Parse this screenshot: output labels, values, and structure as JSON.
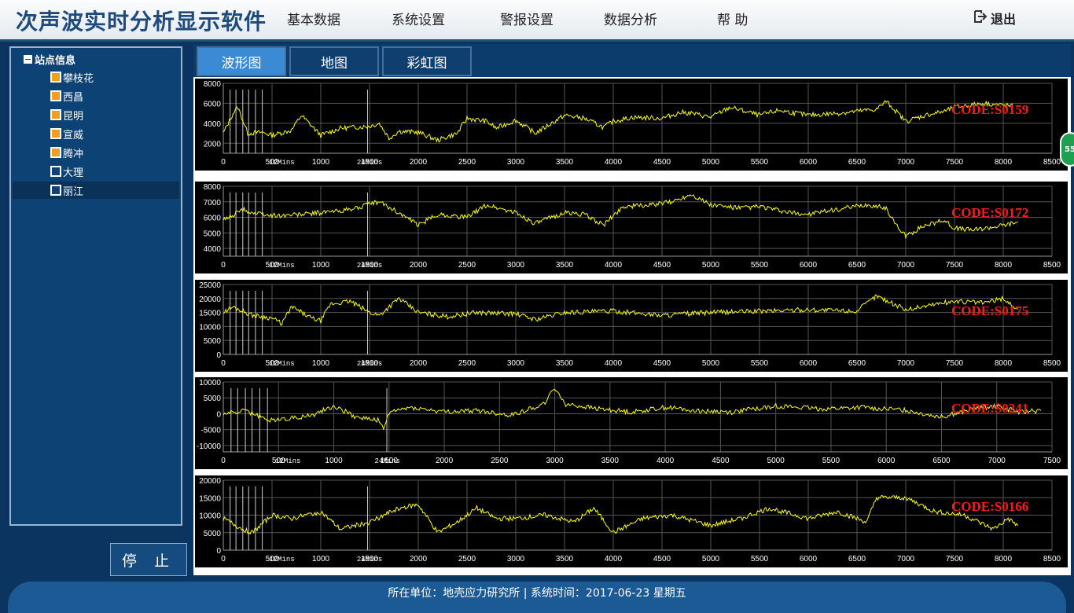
{
  "app": {
    "title": "次声波实时分析显示软件"
  },
  "menu": {
    "items": [
      {
        "label": "基本数据"
      },
      {
        "label": "系统设置"
      },
      {
        "label": "警报设置"
      },
      {
        "label": "数据分析"
      },
      {
        "label": "帮 助"
      }
    ],
    "logout_label": "退出"
  },
  "sidebar": {
    "root_label": "站点信息",
    "stations": [
      {
        "name": "攀枝花",
        "status": "active"
      },
      {
        "name": "西昌",
        "status": "active"
      },
      {
        "name": "昆明",
        "status": "active"
      },
      {
        "name": "宣威",
        "status": "active"
      },
      {
        "name": "腾冲",
        "status": "active"
      },
      {
        "name": "大理",
        "status": "inactive"
      },
      {
        "name": "丽江",
        "status": "inactive"
      }
    ],
    "stop_label": "停 止"
  },
  "tabs": [
    {
      "label": "波形图",
      "active": true
    },
    {
      "label": "地图",
      "active": false
    },
    {
      "label": "彩虹图",
      "active": false
    }
  ],
  "badge": {
    "text": "55"
  },
  "colors": {
    "trace": "#ffff00",
    "code_label": "#ff1a1a",
    "grid": "#555555",
    "active_tab": "#3b8ad4",
    "station_active": "#f0a020"
  },
  "chart_data": [
    {
      "type": "line",
      "code_label": "CODE:S0159",
      "xlim": [
        0,
        8500
      ],
      "x_ticks": [
        0,
        500,
        1000,
        1500,
        2000,
        2500,
        3000,
        3500,
        4000,
        4500,
        5000,
        5500,
        6000,
        6500,
        7000,
        7500,
        8000,
        8500
      ],
      "ylim": [
        1000,
        8000
      ],
      "y_ticks": [
        8000,
        6000,
        4000,
        2000
      ],
      "markers": [
        "12Mins",
        "24Mins"
      ],
      "x": [
        0,
        100,
        150,
        250,
        400,
        500,
        700,
        800,
        1000,
        1200,
        1500,
        1600,
        1700,
        1800,
        2000,
        2200,
        2400,
        2500,
        2700,
        2800,
        3000,
        3200,
        3500,
        3700,
        3900,
        4000,
        4200,
        4500,
        4700,
        4800,
        5000,
        5200,
        5500,
        5700,
        6000,
        6300,
        6500,
        6700,
        6800,
        7000,
        7200,
        7400,
        7500,
        7800,
        8100
      ],
      "y": [
        3000,
        5000,
        5600,
        3000,
        3100,
        2800,
        3300,
        4800,
        2800,
        3500,
        3700,
        4000,
        2500,
        3200,
        3100,
        2300,
        3000,
        4500,
        4200,
        3500,
        4300,
        3000,
        4800,
        4500,
        3600,
        4200,
        4600,
        4500,
        5100,
        5000,
        4600,
        5600,
        4800,
        5300,
        4800,
        5000,
        5200,
        5400,
        6200,
        4200,
        4800,
        5200,
        5600,
        6000,
        5700
      ]
    },
    {
      "type": "line",
      "code_label": "CODE:S0172",
      "xlim": [
        0,
        8500
      ],
      "x_ticks": [
        0,
        500,
        1000,
        1500,
        2000,
        2500,
        3000,
        3500,
        4000,
        4500,
        5000,
        5500,
        6000,
        6500,
        7000,
        7500,
        8000,
        8500
      ],
      "ylim": [
        3500,
        8000
      ],
      "y_ticks": [
        8000,
        7000,
        6000,
        5000,
        4000
      ],
      "markers": [
        "12Mins",
        "24Mins"
      ],
      "x": [
        0,
        200,
        300,
        500,
        800,
        1000,
        1300,
        1600,
        1800,
        2000,
        2200,
        2500,
        2700,
        3000,
        3200,
        3500,
        3700,
        3900,
        4100,
        4400,
        4600,
        4800,
        5000,
        5300,
        5500,
        5800,
        6000,
        6300,
        6600,
        6800,
        6900,
        7000,
        7200,
        7400,
        7500,
        7700,
        8000,
        8150
      ],
      "y": [
        5800,
        6500,
        6300,
        6100,
        6200,
        6300,
        6500,
        7000,
        6300,
        5500,
        6200,
        6000,
        6800,
        6300,
        5600,
        6300,
        6200,
        5500,
        6700,
        6800,
        7000,
        7500,
        6800,
        6600,
        6700,
        6300,
        6200,
        6500,
        6800,
        6600,
        5500,
        4800,
        5500,
        5800,
        5300,
        5200,
        5500,
        5700
      ]
    },
    {
      "type": "line",
      "code_label": "CODE:S0175",
      "xlim": [
        0,
        8500
      ],
      "x_ticks": [
        0,
        500,
        1000,
        1500,
        2000,
        2500,
        3000,
        3500,
        4000,
        4500,
        5000,
        5500,
        6000,
        6500,
        7000,
        7500,
        8000,
        8500
      ],
      "ylim": [
        0,
        25000
      ],
      "y_ticks": [
        25000,
        20000,
        15000,
        10000,
        5000,
        0
      ],
      "markers": [
        "12Mins",
        "24Mins"
      ],
      "x": [
        0,
        100,
        300,
        500,
        600,
        700,
        900,
        1000,
        1100,
        1300,
        1500,
        1600,
        1800,
        2000,
        2300,
        2600,
        3000,
        3200,
        3500,
        4000,
        4500,
        5000,
        5500,
        6000,
        6500,
        6700,
        7000,
        7300,
        7500,
        7800,
        8000,
        8150
      ],
      "y": [
        15000,
        17000,
        14000,
        13000,
        11000,
        17000,
        13000,
        12000,
        18000,
        19000,
        15000,
        14000,
        20000,
        15000,
        13500,
        15000,
        14500,
        12500,
        15000,
        15500,
        14000,
        15000,
        15500,
        16000,
        15500,
        21000,
        16000,
        18000,
        19000,
        18500,
        20000,
        16000
      ]
    },
    {
      "type": "line",
      "code_label": "CODE:S0241",
      "xlim": [
        0,
        7500
      ],
      "x_ticks": [
        0,
        500,
        1000,
        1500,
        2000,
        2500,
        3000,
        3500,
        4000,
        4500,
        5000,
        5500,
        6000,
        6500,
        7000,
        7500
      ],
      "ylim": [
        -12000,
        10000
      ],
      "y_ticks": [
        10000,
        5000,
        0,
        -5000,
        -10000
      ],
      "markers": [
        "12Mins",
        "24Mins"
      ],
      "x": [
        0,
        200,
        400,
        600,
        800,
        1000,
        1200,
        1400,
        1450,
        1500,
        1700,
        2000,
        2300,
        2600,
        2900,
        3000,
        3100,
        3400,
        3700,
        4000,
        4300,
        4600,
        5000,
        5400,
        5800,
        6200,
        6500,
        6800,
        7000,
        7200,
        7400
      ],
      "y": [
        0,
        1000,
        -2000,
        -1500,
        -500,
        2500,
        -1000,
        -2000,
        -5000,
        500,
        2000,
        500,
        1000,
        -500,
        3000,
        8000,
        3000,
        1500,
        500,
        2000,
        1000,
        500,
        2500,
        1500,
        2000,
        1000,
        -1000,
        1500,
        2500,
        500,
        1000
      ]
    },
    {
      "type": "line",
      "code_label": "CODE:S0166",
      "xlim": [
        0,
        8500
      ],
      "x_ticks": [
        0,
        500,
        1000,
        1500,
        2000,
        2500,
        3000,
        3500,
        4000,
        4500,
        5000,
        5500,
        6000,
        6500,
        7000,
        7500,
        8000,
        8500
      ],
      "ylim": [
        0,
        20000
      ],
      "y_ticks": [
        20000,
        15000,
        10000,
        5000,
        0
      ],
      "markers": [
        "12Mins",
        "24Mins"
      ],
      "x": [
        0,
        200,
        300,
        500,
        700,
        1000,
        1200,
        1500,
        1800,
        2000,
        2200,
        2400,
        2600,
        2800,
        3000,
        3300,
        3600,
        3800,
        4000,
        4300,
        4600,
        5000,
        5300,
        5600,
        6000,
        6300,
        6600,
        6700,
        7000,
        7300,
        7600,
        7900,
        8050,
        8150
      ],
      "y": [
        9000,
        6000,
        5000,
        10000,
        9000,
        11000,
        6000,
        8000,
        12000,
        13000,
        5000,
        8000,
        12000,
        9000,
        9000,
        10000,
        8000,
        12000,
        5000,
        9000,
        10000,
        7000,
        9000,
        12000,
        9000,
        11000,
        8000,
        15000,
        15000,
        11000,
        10000,
        6000,
        9000,
        7000
      ]
    }
  ],
  "footer": {
    "org_label": "所在单位：",
    "org": "地壳应力研究所",
    "sep": " | ",
    "time_label": "系统时间：",
    "time": "2017-06-23 星期五"
  }
}
